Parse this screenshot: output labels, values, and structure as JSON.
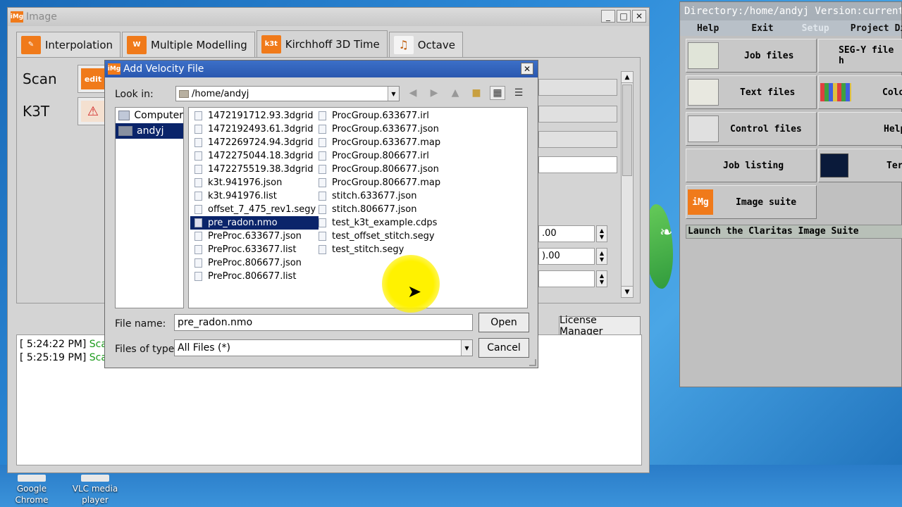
{
  "desktop": {
    "icons": [
      {
        "label_line1": "Google",
        "label_line2": "Chrome"
      },
      {
        "label_line1": "VLC media",
        "label_line2": "player"
      }
    ]
  },
  "image_window": {
    "title": "Image",
    "tabs": [
      {
        "label": "Interpolation",
        "icon": "interpolation-icon"
      },
      {
        "label": "Multiple Modelling",
        "icon": "modelling-icon"
      },
      {
        "label": "Kirchhoff 3D Time",
        "icon": "k3t-icon",
        "badge": "k3t"
      },
      {
        "label": "Octave",
        "icon": "octave-icon"
      }
    ],
    "side": {
      "scan_label": "Scan",
      "scan_btn": "edit",
      "k3t_label": "K3T"
    },
    "fields": {
      "value1": ".00",
      "value2": ").00"
    },
    "license_button": "License Manager",
    "log": [
      {
        "time": "[ 5:24:22 PM]",
        "status": "Scan"
      },
      {
        "time": "[ 5:25:19 PM]",
        "status": "Scan"
      }
    ]
  },
  "dialog": {
    "title": "Add Velocity File",
    "look_in_label": "Look in:",
    "look_in_value": "/home/andyj",
    "places": [
      {
        "label": "Computer",
        "selected": false
      },
      {
        "label": "andyj",
        "selected": true
      }
    ],
    "files_col1": [
      "1472191712.93.3dgrid",
      "1472192493.61.3dgrid",
      "1472269724.94.3dgrid",
      "1472275044.18.3dgrid",
      "1472275519.38.3dgrid",
      "k3t.941976.json",
      "k3t.941976.list",
      "offset_7_475_rev1.segy",
      "pre_radon.nmo",
      "PreProc.633677.json",
      "PreProc.633677.list",
      "PreProc.806677.json",
      "PreProc.806677.list"
    ],
    "files_col2": [
      "ProcGroup.633677.irl",
      "ProcGroup.633677.json",
      "ProcGroup.633677.map",
      "ProcGroup.806677.irl",
      "ProcGroup.806677.json",
      "ProcGroup.806677.map",
      "stitch.633677.json",
      "stitch.806677.json",
      "test_k3t_example.cdps",
      "test_offset_stitch.segy",
      "test_stitch.segy"
    ],
    "selected_file": "pre_radon.nmo",
    "file_name_label": "File name:",
    "file_name_value": "pre_radon.nmo",
    "file_type_label": "Files of type:",
    "file_type_value": "All Files (*)",
    "open_button": "Open",
    "cancel_button": "Cancel"
  },
  "right_window": {
    "title": "Directory:/home/andyj  Version:current Ve",
    "menu": [
      "Help",
      "Exit",
      "Setup",
      "Project",
      "Dir"
    ],
    "cells": [
      {
        "label": "Job files"
      },
      {
        "label": "SEG-Y file h"
      },
      {
        "label": "Text files"
      },
      {
        "label": "Colo"
      },
      {
        "label": "Control files"
      },
      {
        "label": "Help"
      },
      {
        "label": "Job listing"
      },
      {
        "label": "Termi"
      },
      {
        "label": "Image suite",
        "badge": "iMg"
      }
    ],
    "status": "Launch the Claritas Image Suite"
  },
  "colors": {
    "accent": "#f07a1a",
    "selection": "#0a246a",
    "dialog_title": "#2a58b0",
    "log_ok": "#1a9a1a"
  }
}
